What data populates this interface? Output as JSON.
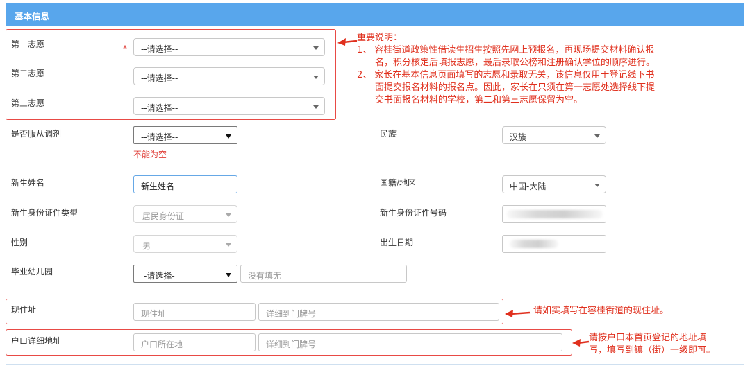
{
  "header": {
    "title": "基本信息"
  },
  "volunteers": {
    "first_label": "第一志愿",
    "second_label": "第二志愿",
    "third_label": "第三志愿",
    "required_mark": "*",
    "first_value": "--请选择--",
    "second_value": "--请选择--",
    "third_value": "--请选择--"
  },
  "notes": {
    "important": {
      "title": "重要说明：",
      "lines": [
        "1、 容桂街道政策性借读生招生按照先网上预报名，再现场提交材料确认报",
        "名，积分核定后填报志愿，最后录取公榜和注册确认学位的顺序进行。",
        "2、 家长在基本信息页面填写的志愿和录取无关，该信息仅用于登记线下书",
        "面提交报名材料的报名点。因此，家长在只须在第一志愿处选择线下提",
        "交书面报名材料的学校，第二和第三志愿保留为空。"
      ]
    },
    "address": "请如实填写在容桂街道的现住址。",
    "hukou": [
      "请按户口本首页登记的地址填",
      "写，填写到镇（街）一级即可。"
    ]
  },
  "fields": {
    "obey_label": "是否服从调剂",
    "obey_value": "--请选择--",
    "obey_error": "不能为空",
    "ethnic_label": "民族",
    "ethnic_value": "汉族",
    "name_label": "新生姓名",
    "name_value": "新生姓名",
    "nationality_label": "国籍/地区",
    "nationality_value": "中国-大陆",
    "id_type_label": "新生身份证件类型",
    "id_type_value": "居民身份证",
    "id_number_label": "新生身份证件号码",
    "gender_label": "性别",
    "gender_value": "男",
    "birth_label": "出生日期",
    "kindergarten_label": "毕业幼儿园",
    "kindergarten_value": "-请选择-",
    "kindergarten_placeholder": "没有填无",
    "current_address_label": "现住址",
    "current_address_placeholder": "现住址",
    "current_detail_placeholder": "详细到门牌号",
    "hukou_label": "户口详细地址",
    "hukou_placeholder": "户口所在地",
    "hukou_detail_placeholder": "详细到门牌号"
  },
  "colors": {
    "header": "#58a6ec",
    "annotation": "#e0301e"
  }
}
